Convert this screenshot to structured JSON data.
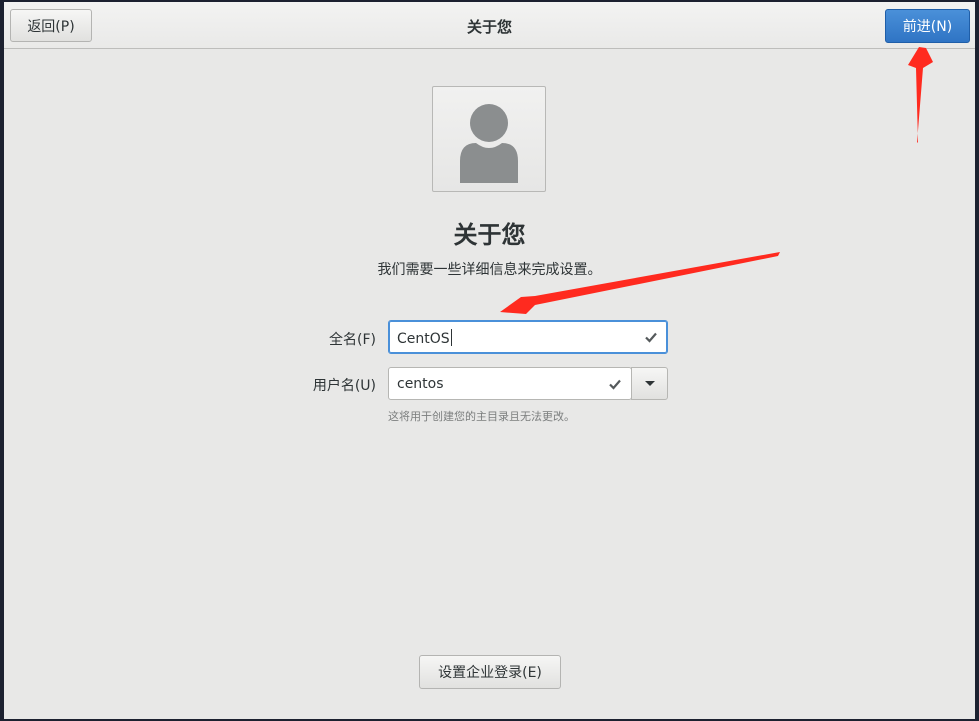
{
  "header": {
    "back_label": "返回(P)",
    "title": "关于您",
    "forward_label": "前进(N)"
  },
  "avatar": {
    "icon": "user-avatar-icon"
  },
  "page": {
    "title": "关于您",
    "subtitle": "我们需要一些详细信息来完成设置。"
  },
  "form": {
    "fullname_label": "全名(F)",
    "fullname_value": "CentOS",
    "username_label": "用户名(U)",
    "username_value": "centos",
    "hint": "这将用于创建您的主目录且无法更改。"
  },
  "footer": {
    "enterprise_login_label": "设置企业登录(E)"
  },
  "colors": {
    "accent": "#4a90d9",
    "annotation_arrow": "#ff2a1f"
  }
}
